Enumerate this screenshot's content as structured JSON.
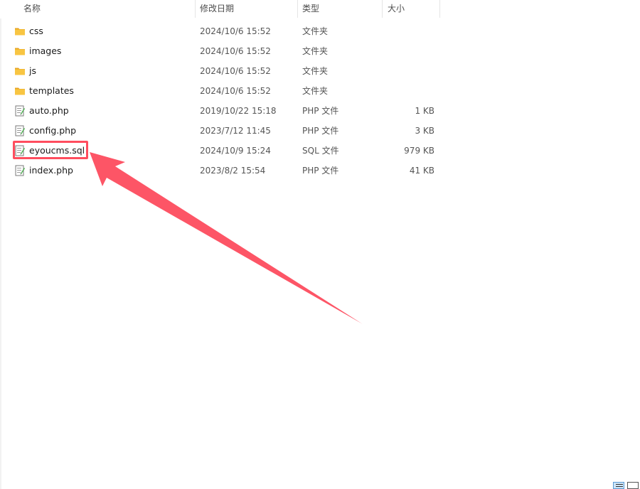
{
  "columns": {
    "name": "名称",
    "modified": "修改日期",
    "type": "类型",
    "size": "大小"
  },
  "files": [
    {
      "name": "css",
      "modified": "2024/10/6 15:52",
      "type": "文件夹",
      "size": "",
      "icon": "folder-icon"
    },
    {
      "name": "images",
      "modified": "2024/10/6 15:52",
      "type": "文件夹",
      "size": "",
      "icon": "folder-icon"
    },
    {
      "name": "js",
      "modified": "2024/10/6 15:52",
      "type": "文件夹",
      "size": "",
      "icon": "folder-icon"
    },
    {
      "name": "templates",
      "modified": "2024/10/6 15:52",
      "type": "文件夹",
      "size": "",
      "icon": "folder-icon"
    },
    {
      "name": "auto.php",
      "modified": "2019/10/22 15:18",
      "type": "PHP 文件",
      "size": "1 KB",
      "icon": "text-file-icon"
    },
    {
      "name": "config.php",
      "modified": "2023/7/12 11:45",
      "type": "PHP 文件",
      "size": "3 KB",
      "icon": "text-file-icon"
    },
    {
      "name": "eyoucms.sql",
      "modified": "2024/10/9 15:24",
      "type": "SQL 文件",
      "size": "979 KB",
      "icon": "text-file-icon"
    },
    {
      "name": "index.php",
      "modified": "2023/8/2 15:54",
      "type": "PHP 文件",
      "size": "41 KB",
      "icon": "text-file-icon"
    }
  ],
  "highlighted_file": "eyoucms.sql",
  "colors": {
    "annotation": "#ff4d5e",
    "folder": "#f8c542",
    "header_text": "#4d4d4d"
  }
}
